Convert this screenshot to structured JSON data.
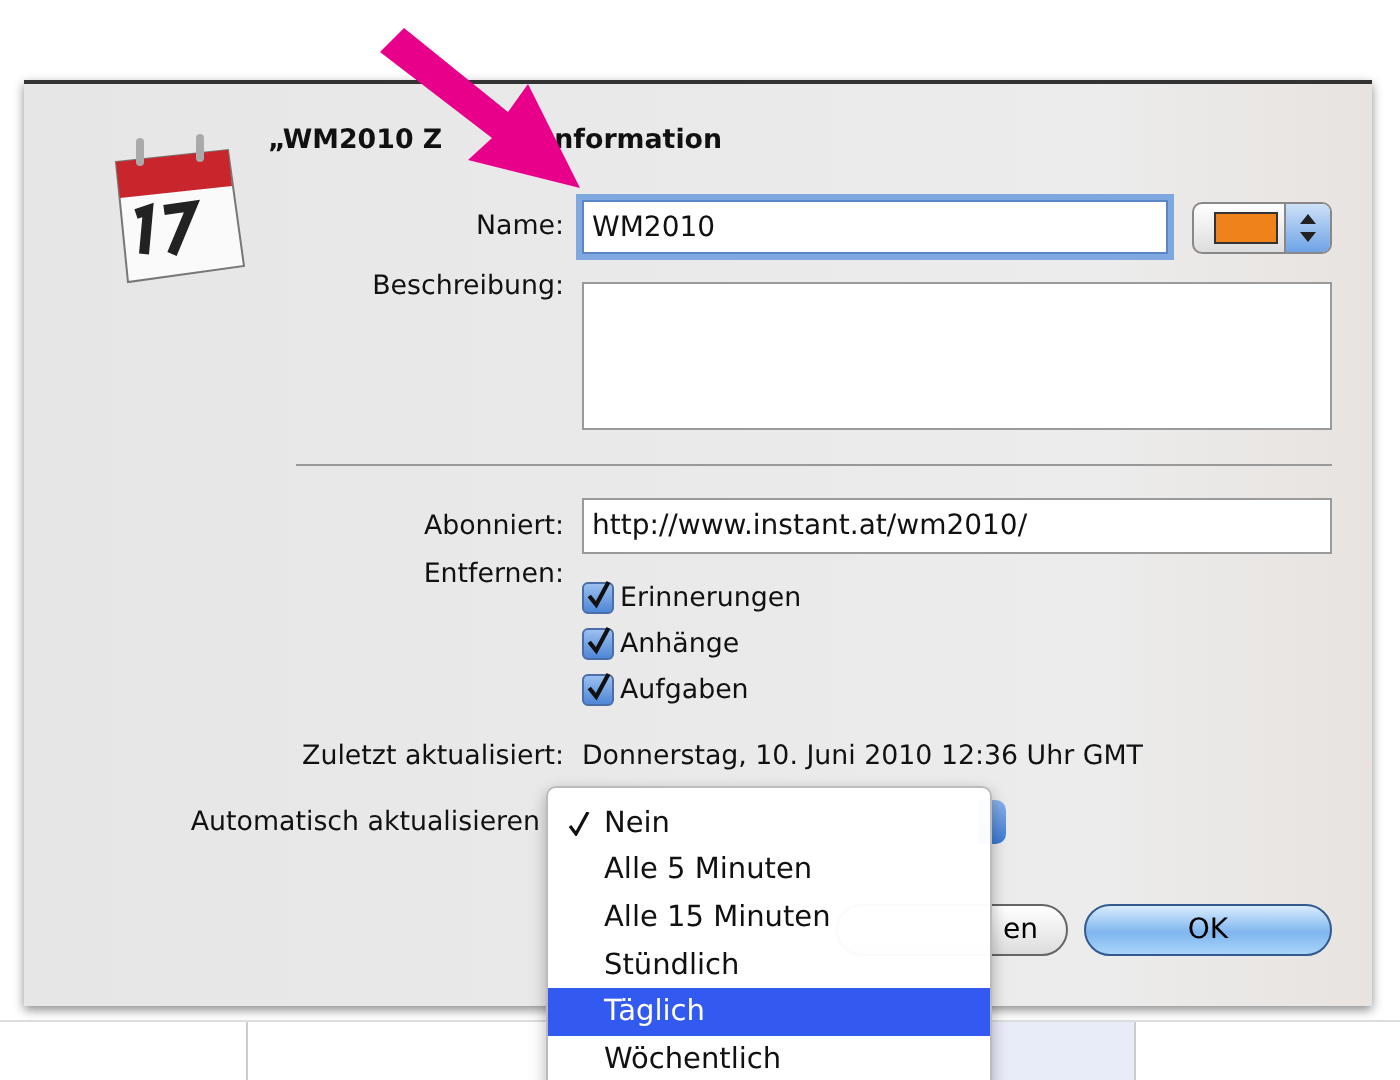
{
  "dialog": {
    "title_start": "„WM2010 Z",
    "title_end": "nformation",
    "name": {
      "label": "Name:",
      "value": "WM2010",
      "focused": true
    },
    "color": "#f0821c",
    "description": {
      "label": "Beschreibung:"
    },
    "subscribed": {
      "label": "Abonniert:",
      "value": "http://www.instant.at/wm2010/"
    },
    "remove": {
      "label": "Entfernen:",
      "options": [
        {
          "label": "Erinnerungen",
          "checked": true
        },
        {
          "label": "Anhänge",
          "checked": true
        },
        {
          "label": "Aufgaben",
          "checked": true
        }
      ]
    },
    "last_updated": {
      "label": "Zuletzt aktualisiert:",
      "value": "Donnerstag, 10. Juni 2010 12:36 Uhr GMT"
    },
    "auto_update": {
      "label": "Automatisch aktualisieren"
    },
    "buttons": [
      {
        "kind": "secondary",
        "label": "en"
      },
      {
        "kind": "default",
        "label": "OK"
      }
    ]
  },
  "menu": {
    "items": [
      {
        "label": "Nein",
        "checked": true,
        "selected": false
      },
      {
        "label": "Alle 5 Minuten",
        "checked": false,
        "selected": false
      },
      {
        "label": "Alle 15 Minuten",
        "checked": false,
        "selected": false
      },
      {
        "label": "Stündlich",
        "checked": false,
        "selected": false
      },
      {
        "label": "Täglich",
        "checked": false,
        "selected": true
      },
      {
        "label": "Wöchentlich",
        "checked": false,
        "selected": false
      }
    ]
  }
}
